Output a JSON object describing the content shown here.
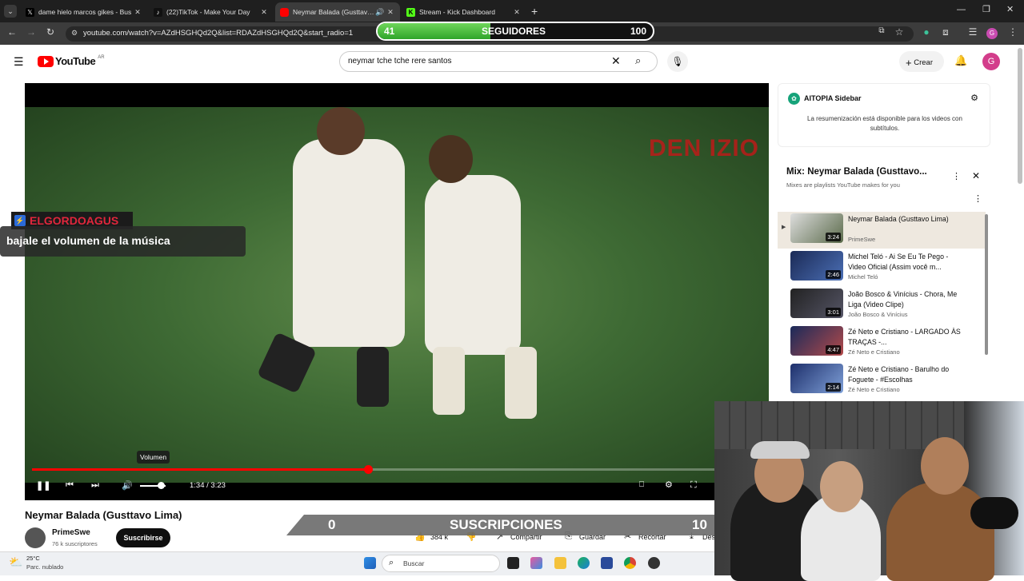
{
  "browser": {
    "tabs": [
      {
        "title": "dame hielo marcos gikes - Bus",
        "icon": "x-icon",
        "active": false
      },
      {
        "title": "(22)TikTok - Make Your Day",
        "icon": "tiktok-icon",
        "active": false
      },
      {
        "title": "Neymar Balada (Gusttavo Li",
        "icon": "youtube-icon",
        "active": true
      },
      {
        "title": "Stream - Kick Dashboard",
        "icon": "kick-icon",
        "active": false
      }
    ],
    "url": "youtube.com/watch?v=AZdHSGHQd2Q&list=RDAZdHSGHQd2Q&start_radio=1",
    "profile_initial": "G"
  },
  "overlay": {
    "followers_current": "41",
    "followers_label": "SEGUIDORES",
    "followers_goal": "100",
    "followers_progress": 0.41,
    "chat_user": "ELGORDOAGUS",
    "chat_message": "bajale el volumen de la música",
    "subs_current": "0",
    "subs_label": "SUSCRIPCIONES",
    "subs_goal": "10"
  },
  "youtube": {
    "logo": "YouTube",
    "region": "AR",
    "search_value": "neymar tche tche rere santos",
    "create_label": "Crear",
    "avatar_initial": "G"
  },
  "video": {
    "watermark": "DEN IZIO",
    "time": "1:34 / 3:23",
    "progress": 0.46,
    "tooltip": "Volumen",
    "title": "Neymar Balada (Gusttavo Lima)",
    "channel": "PrimeSwe",
    "subscribers": "76 k suscriptores",
    "subscribe_label": "Suscribirse",
    "likes": "384 k",
    "share_label": "Compartir",
    "save_label": "Guardar",
    "clip_label": "Recortar",
    "download_label": "Des"
  },
  "sidebar": {
    "title": "AITOPIA Sidebar",
    "message": "La resumenización está disponible para los videos con subtítulos."
  },
  "playlist": {
    "title": "Mix: Neymar Balada (Gusttavo...",
    "subtitle": "Mixes are playlists YouTube makes for you",
    "items": [
      {
        "title": "Neymar Balada (Gusttavo Lima)",
        "channel": "PrimeSwe",
        "duration": "3:24"
      },
      {
        "title": "Michel Teló - Ai Se Eu Te Pego - Video Oficial (Assim você m...",
        "channel": "Michel Teló",
        "duration": "2:46"
      },
      {
        "title": "João Bosco & Vinícius - Chora, Me Liga (Video Clipe)",
        "channel": "João Bosco & Vinícius",
        "duration": "3:01"
      },
      {
        "title": "Zé Neto e Cristiano - LARGADO ÀS TRAÇAS -...",
        "channel": "Zé Neto e Cristiano",
        "duration": "4:47"
      },
      {
        "title": "Zé Neto e Cristiano - Barulho do Foguete - #Escolhas",
        "channel": "Zé Neto e Cristiano",
        "duration": "2:14"
      }
    ]
  },
  "taskbar": {
    "temp": "25°C",
    "weather": "Parc. nublado",
    "search_placeholder": "Buscar"
  },
  "colors": {
    "youtube_red": "#ff0000",
    "follow_green": "#3db832",
    "chat_user_red": "#e0263c"
  }
}
